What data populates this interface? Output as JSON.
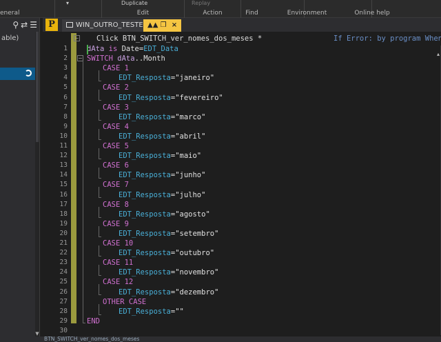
{
  "ribbon": {
    "groups": [
      {
        "label": "General",
        "shown": "eneral"
      },
      {
        "label": "Edit"
      },
      {
        "label": "Action"
      },
      {
        "label": "Find"
      },
      {
        "label": "Environment"
      },
      {
        "label": "Online help"
      }
    ],
    "duplicate_label": "Duplicate",
    "replay_label": "Replay"
  },
  "left_panel": {
    "item_label": "able)",
    "search_icon": "search-icon",
    "sync_icon": "sync-icon",
    "list_icon": "list-icon"
  },
  "tabs": [
    {
      "label": "WIN_OUTRO_TESTE",
      "active": false
    },
    {
      "label": "",
      "active": true
    }
  ],
  "editor": {
    "header_title": "Click BTN_SWITCH_ver_nomes_dos_meses  *",
    "if_error": "If Error: by program When",
    "lines": [
      {
        "n": "1",
        "indent": 0,
        "tokens": [
          [
            "var",
            "dAta"
          ],
          [
            "kw",
            " is "
          ],
          [
            "plain",
            "Date"
          ],
          [
            "plain",
            "="
          ],
          [
            "ctl",
            "EDT_Data"
          ]
        ]
      },
      {
        "n": "2",
        "indent": 0,
        "tokens": [
          [
            "kw",
            "SWITCH "
          ],
          [
            "var",
            "dAta"
          ],
          [
            "plain",
            "..Month"
          ]
        ]
      },
      {
        "n": "3",
        "indent": 1,
        "tokens": [
          [
            "kw",
            "CASE 1"
          ]
        ]
      },
      {
        "n": "4",
        "indent": 2,
        "tokens": [
          [
            "ctl",
            "EDT_Resposta"
          ],
          [
            "plain",
            "="
          ],
          [
            "str",
            "\"janeiro\""
          ]
        ]
      },
      {
        "n": "5",
        "indent": 1,
        "tokens": [
          [
            "kw",
            "CASE 2"
          ]
        ]
      },
      {
        "n": "6",
        "indent": 2,
        "tokens": [
          [
            "ctl",
            "EDT_Resposta"
          ],
          [
            "plain",
            "="
          ],
          [
            "str",
            "\"fevereiro\""
          ]
        ]
      },
      {
        "n": "7",
        "indent": 1,
        "tokens": [
          [
            "kw",
            "CASE 3"
          ]
        ]
      },
      {
        "n": "8",
        "indent": 2,
        "tokens": [
          [
            "ctl",
            "EDT_Resposta"
          ],
          [
            "plain",
            "="
          ],
          [
            "str",
            "\"marco\""
          ]
        ]
      },
      {
        "n": "9",
        "indent": 1,
        "tokens": [
          [
            "kw",
            "CASE 4"
          ]
        ]
      },
      {
        "n": "10",
        "indent": 2,
        "tokens": [
          [
            "ctl",
            "EDT_Resposta"
          ],
          [
            "plain",
            "="
          ],
          [
            "str",
            "\"abril\""
          ]
        ]
      },
      {
        "n": "11",
        "indent": 1,
        "tokens": [
          [
            "kw",
            "CASE 5"
          ]
        ]
      },
      {
        "n": "12",
        "indent": 2,
        "tokens": [
          [
            "ctl",
            "EDT_Resposta"
          ],
          [
            "plain",
            "="
          ],
          [
            "str",
            "\"maio\""
          ]
        ]
      },
      {
        "n": "13",
        "indent": 1,
        "tokens": [
          [
            "kw",
            "CASE 6"
          ]
        ]
      },
      {
        "n": "14",
        "indent": 2,
        "tokens": [
          [
            "ctl",
            "EDT_Resposta"
          ],
          [
            "plain",
            "="
          ],
          [
            "str",
            "\"junho\""
          ]
        ]
      },
      {
        "n": "15",
        "indent": 1,
        "tokens": [
          [
            "kw",
            "CASE 7"
          ]
        ]
      },
      {
        "n": "16",
        "indent": 2,
        "tokens": [
          [
            "ctl",
            "EDT_Resposta"
          ],
          [
            "plain",
            "="
          ],
          [
            "str",
            "\"julho\""
          ]
        ]
      },
      {
        "n": "17",
        "indent": 1,
        "tokens": [
          [
            "kw",
            "CASE 8"
          ]
        ]
      },
      {
        "n": "18",
        "indent": 2,
        "tokens": [
          [
            "ctl",
            "EDT_Resposta"
          ],
          [
            "plain",
            "="
          ],
          [
            "str",
            "\"agosto\""
          ]
        ]
      },
      {
        "n": "19",
        "indent": 1,
        "tokens": [
          [
            "kw",
            "CASE 9"
          ]
        ]
      },
      {
        "n": "20",
        "indent": 2,
        "tokens": [
          [
            "ctl",
            "EDT_Resposta"
          ],
          [
            "plain",
            "="
          ],
          [
            "str",
            "\"setembro\""
          ]
        ]
      },
      {
        "n": "21",
        "indent": 1,
        "tokens": [
          [
            "kw",
            "CASE 10"
          ]
        ]
      },
      {
        "n": "22",
        "indent": 2,
        "tokens": [
          [
            "ctl",
            "EDT_Resposta"
          ],
          [
            "plain",
            "="
          ],
          [
            "str",
            "\"outubro\""
          ]
        ]
      },
      {
        "n": "23",
        "indent": 1,
        "tokens": [
          [
            "kw",
            "CASE 11"
          ]
        ]
      },
      {
        "n": "24",
        "indent": 2,
        "tokens": [
          [
            "ctl",
            "EDT_Resposta"
          ],
          [
            "plain",
            "="
          ],
          [
            "str",
            "\"novembro\""
          ]
        ]
      },
      {
        "n": "25",
        "indent": 1,
        "tokens": [
          [
            "kw",
            "CASE 12"
          ]
        ]
      },
      {
        "n": "26",
        "indent": 2,
        "tokens": [
          [
            "ctl",
            "EDT_Resposta"
          ],
          [
            "plain",
            "="
          ],
          [
            "str",
            "\"dezembro\""
          ]
        ]
      },
      {
        "n": "27",
        "indent": 1,
        "tokens": [
          [
            "kw",
            "OTHER CASE"
          ]
        ]
      },
      {
        "n": "28",
        "indent": 2,
        "tokens": [
          [
            "ctl",
            "EDT_Resposta"
          ],
          [
            "plain",
            "="
          ],
          [
            "str",
            "\"\""
          ]
        ]
      },
      {
        "n": "29",
        "indent": 0,
        "tokens": [
          [
            "kw",
            "END"
          ]
        ]
      },
      {
        "n": "30",
        "indent": 0,
        "tokens": []
      }
    ]
  },
  "status": {
    "text": "BTN_SWITCH_ver_nomes_dos_meses"
  },
  "colors": {
    "keyword": "#d070d0",
    "control": "#4ab0d8",
    "variable": "#c8a0e0",
    "gutter_bar": "#9b9a3e",
    "active_tab": "#f5c542"
  }
}
